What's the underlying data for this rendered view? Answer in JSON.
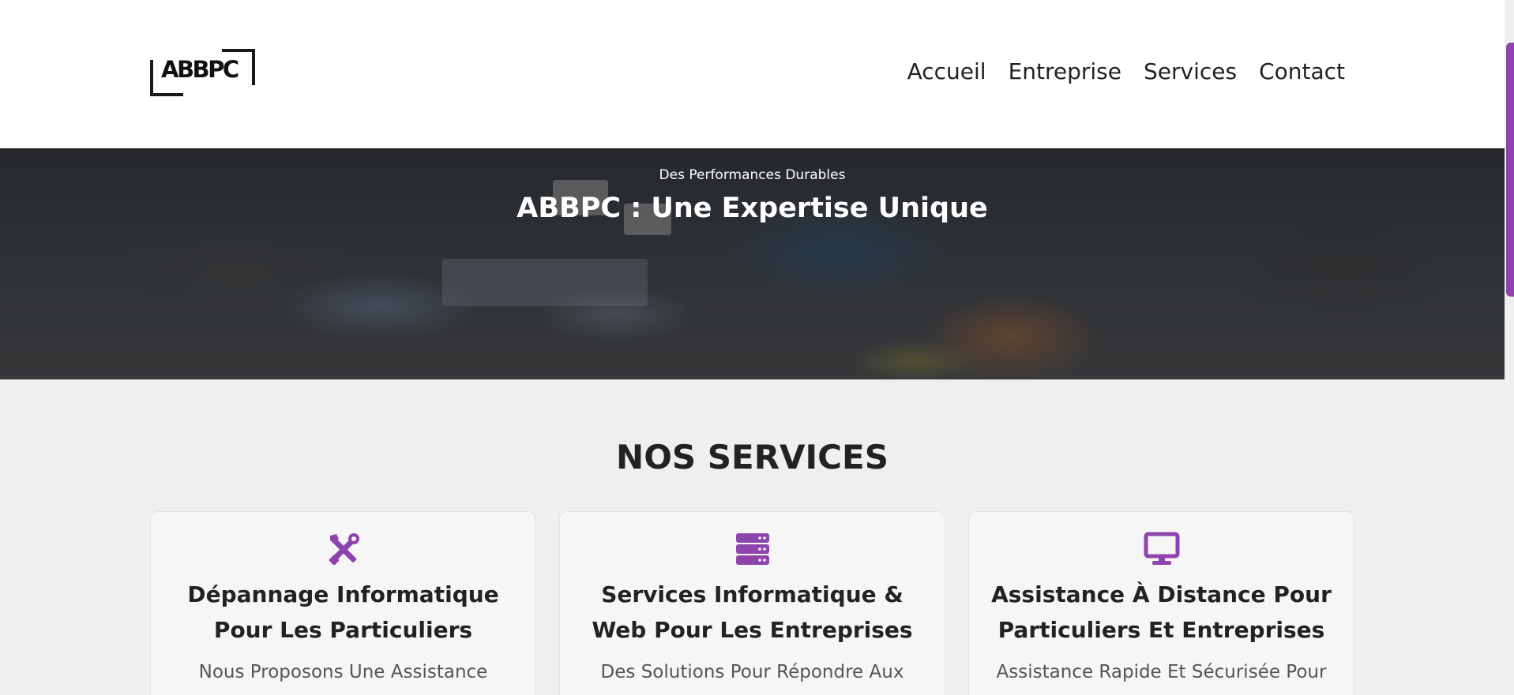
{
  "brand": {
    "logo_text": "ABBPC"
  },
  "nav": {
    "items": [
      {
        "label": "Accueil"
      },
      {
        "label": "Entreprise"
      },
      {
        "label": "Services"
      },
      {
        "label": "Contact"
      }
    ]
  },
  "hero": {
    "subtitle": "Des Performances Durables",
    "title": "ABBPC : Une Expertise Unique"
  },
  "services": {
    "heading": "NOS SERVICES",
    "cards": [
      {
        "icon": "tools-icon",
        "title": "Dépannage Informatique Pour Les Particuliers",
        "text": "Nous Proposons Une Assistance"
      },
      {
        "icon": "server-icon",
        "title": "Services Informatique & Web Pour Les Entreprises",
        "text": "Des Solutions Pour Répondre Aux"
      },
      {
        "icon": "monitor-icon",
        "title": "Assistance À Distance Pour Particuliers Et Entreprises",
        "text": "Assistance Rapide Et Sécurisée Pour"
      }
    ]
  },
  "colors": {
    "accent": "#8e44ad",
    "background": "#efefef",
    "header": "#ffffff",
    "text": "#222222"
  }
}
